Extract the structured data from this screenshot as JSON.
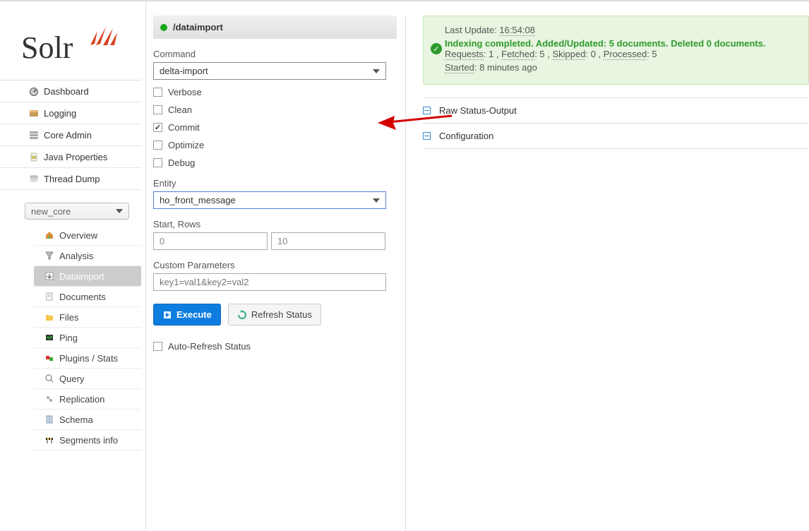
{
  "logo": {
    "text": "Solr"
  },
  "nav": {
    "dashboard": "Dashboard",
    "logging": "Logging",
    "core_admin": "Core Admin",
    "java_props": "Java Properties",
    "thread_dump": "Thread Dump"
  },
  "core_select": {
    "value": "new_core"
  },
  "subnav": {
    "overview": "Overview",
    "analysis": "Analysis",
    "dataimport": "Dataimport",
    "documents": "Documents",
    "files": "Files",
    "ping": "Ping",
    "plugins": "Plugins / Stats",
    "query": "Query",
    "replication": "Replication",
    "schema": "Schema",
    "segments": "Segments info"
  },
  "header": {
    "title": "/dataimport"
  },
  "form": {
    "command_label": "Command",
    "command_value": "delta-import",
    "verbose": "Verbose",
    "clean": "Clean",
    "commit": "Commit",
    "optimize": "Optimize",
    "debug": "Debug",
    "entity_label": "Entity",
    "entity_value": "ho_front_message",
    "startrows_label": "Start, Rows",
    "start_value": "0",
    "rows_value": "10",
    "custom_label": "Custom Parameters",
    "custom_placeholder": "key1=val1&key2=val2",
    "execute": "Execute",
    "refresh": "Refresh Status",
    "autorefresh": "Auto-Refresh Status"
  },
  "status": {
    "last_update_label": "Last Update: ",
    "last_update_time": "16:54:08",
    "headline": "Indexing completed. Added/Updated: 5 documents. Deleted 0 documents.",
    "requests_label": "Requests",
    "requests_val": ": 1 , ",
    "fetched_label": "Fetched",
    "fetched_val": ": 5 , ",
    "skipped_label": "Skipped",
    "skipped_val": ": 0 , ",
    "processed_label": "Processed",
    "processed_val": ": 5",
    "started_label": "Started",
    "started_val": ": 8 minutes ago"
  },
  "sections": {
    "raw": "Raw Status-Output",
    "config": "Configuration"
  }
}
